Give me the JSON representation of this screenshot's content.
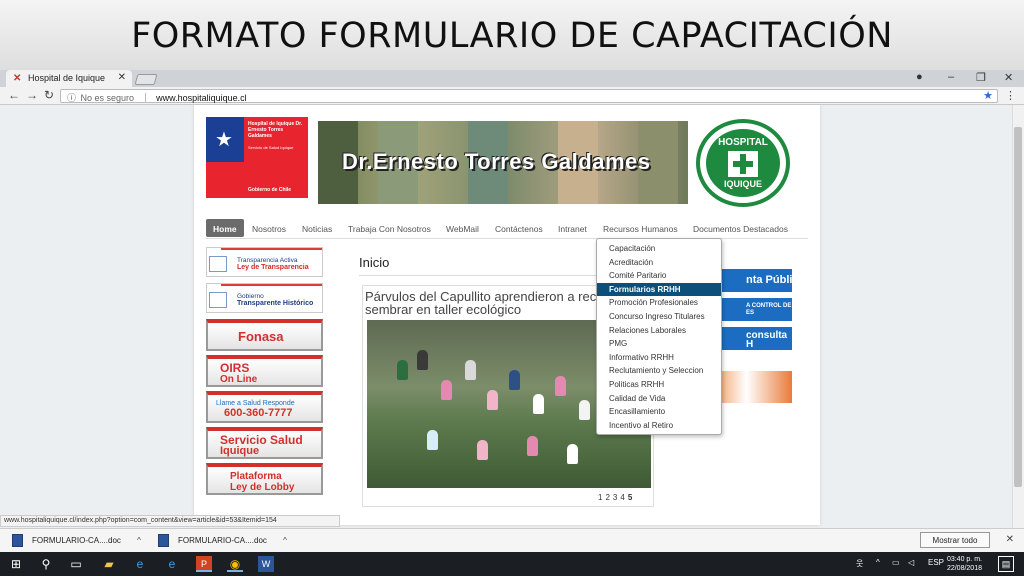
{
  "slide": {
    "title": "FORMATO FORMULARIO DE CAPACITACIÓN"
  },
  "browser": {
    "tab_title": "Hospital de Iquique",
    "address_security": "No es seguro",
    "address_url": "www.hospitaliquique.cl",
    "status_url": "www.hospitaliquique.cl/index.php?option=com_content&view=article&id=53&Itemid=154"
  },
  "site": {
    "gob_logo": {
      "line1": "Hospital de Iquique Dr. Ernesto Torres Galdames",
      "line2": "Servicio de Salud Iquique",
      "line3": "Gobierno de Chile"
    },
    "banner_name": "Dr.Ernesto Torres Galdames",
    "hosp_logo_top": "HOSPITAL",
    "hosp_logo_bottom": "IQUIQUE",
    "nav": [
      "Home",
      "Nosotros",
      "Noticias",
      "Trabaja Con Nosotros",
      "WebMail",
      "Contáctenos",
      "Intranet",
      "Recursos Humanos",
      "Documentos Destacados"
    ],
    "sidebar": {
      "transparencia": {
        "l1": "Transparencia Activa",
        "l2": "Ley de Transparencia"
      },
      "gobierno": {
        "l1": "Gobierno",
        "l2": "Transparente Histórico"
      },
      "fonasa": "Fonasa",
      "oirs": {
        "l1": "OIRS",
        "l2": "On Line"
      },
      "salud_responde": {
        "l1": "Llame a Salud Responde",
        "l2": "600-360-7777"
      },
      "servicio": {
        "l1": "Servicio Salud",
        "l2": "Iquique"
      },
      "lobby": {
        "l1": "Plataforma",
        "l2": "Ley de Lobby"
      }
    },
    "heading": "Inicio",
    "article_title": "Párvulos del Capullito aprendieron a reciclar y a sembrar en taller ecológico",
    "pager": [
      "1",
      "2",
      "3",
      "4",
      "5"
    ],
    "right_buttons": {
      "b1": "nta Pública",
      "b2_l1": "A CONTROL DE",
      "b2_l2": "ES",
      "b3_l1": "consulta",
      "b3_l2": "H"
    },
    "dropdown": {
      "items": [
        "Capacitación",
        "Acreditación",
        "Comité Paritario",
        "Formularios RRHH",
        "Promoción Profesionales",
        "Concurso Ingreso Titulares",
        "Relaciones Laborales",
        "PMG",
        "Informativo RRHH",
        "Reclutamiento y Seleccion",
        "Politicas RRHH",
        "Calidad de Vida",
        "Encasillamiento",
        "Incentivo al Retiro"
      ],
      "highlighted": "Formularios RRHH"
    }
  },
  "downloads": {
    "items": [
      "FORMULARIO-CA....doc",
      "FORMULARIO-CA....doc"
    ],
    "show_all": "Mostrar todo"
  },
  "taskbar": {
    "lang": "ESP",
    "time": "03:40 p. m.",
    "date": "22/08/2018"
  },
  "colors": {
    "accent": "#0b4f7a",
    "gob_red": "#e8252f",
    "gob_blue": "#1b3f95",
    "hospital_green": "#1d8a3f"
  }
}
